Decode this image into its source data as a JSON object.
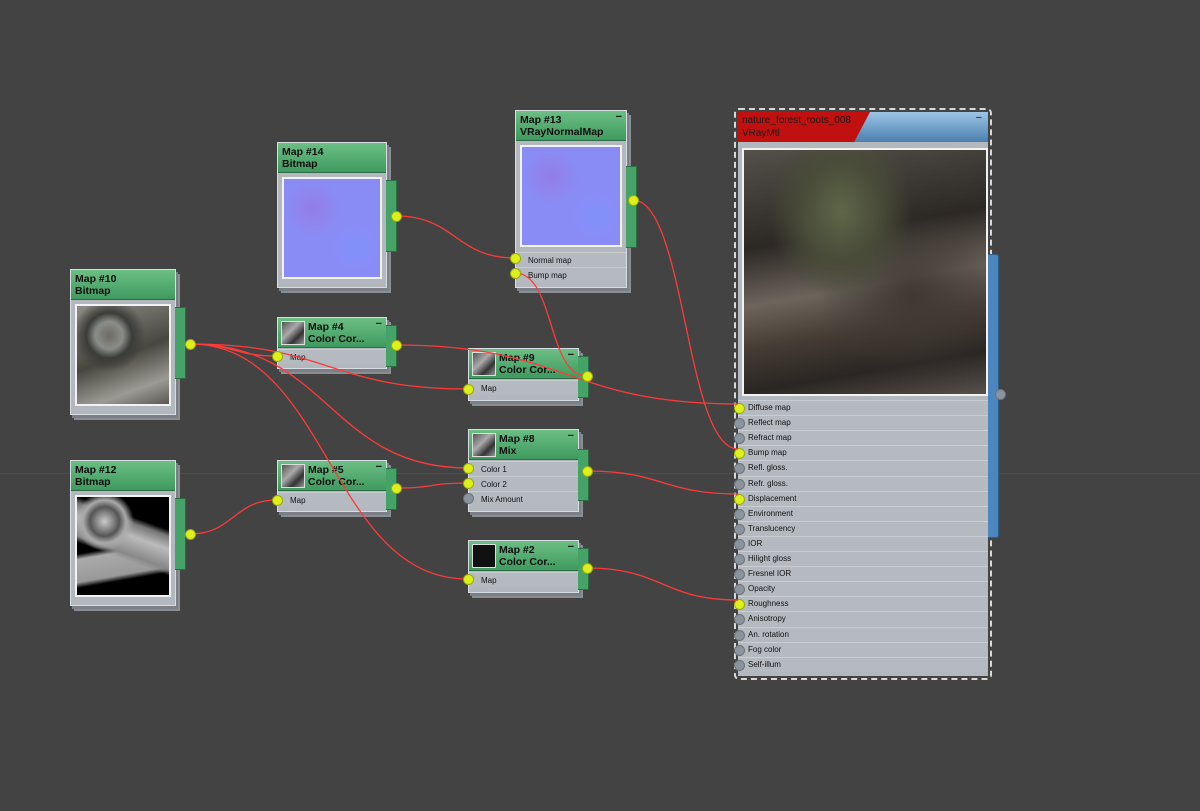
{
  "nodes": {
    "map10": {
      "title": "Map #10",
      "type": "Bitmap"
    },
    "map12": {
      "title": "Map #12",
      "type": "Bitmap"
    },
    "map14": {
      "title": "Map #14",
      "type": "Bitmap"
    },
    "map13": {
      "title": "Map #13",
      "type": "VRayNormalMap",
      "slots": [
        "Normal map",
        "Bump map"
      ]
    },
    "map4": {
      "title": "Map #4",
      "type": "Color Cor...",
      "slots": [
        "Map"
      ]
    },
    "map5": {
      "title": "Map #5",
      "type": "Color Cor...",
      "slots": [
        "Map"
      ]
    },
    "map9": {
      "title": "Map #9",
      "type": "Color Cor...",
      "slots": [
        "Map"
      ]
    },
    "map8": {
      "title": "Map #8",
      "type": "Mix",
      "slots": [
        "Color 1",
        "Color 2",
        "Mix Amount"
      ]
    },
    "map2": {
      "title": "Map #2",
      "type": "Color Cor...",
      "slots": [
        "Map"
      ]
    }
  },
  "material": {
    "name": "nature_forest_roots_008",
    "type": "VRayMtl",
    "slots": [
      "Diffuse map",
      "Reflect map",
      "Refract map",
      "Bump map",
      "Refl. gloss.",
      "Refr. gloss.",
      "Displacement",
      "Environment",
      "Translucency",
      "IOR",
      "Hilight gloss",
      "Fresnel IOR",
      "Opacity",
      "Roughness",
      "Anisotropy",
      "An. rotation",
      "Fog color",
      "Self-illum"
    ],
    "connected_slots": [
      "Diffuse map",
      "Bump map",
      "Displacement",
      "Roughness"
    ]
  },
  "ui": {
    "minimize_glyph": "−"
  },
  "colors": {
    "node_header": "#4fae6f",
    "material_header": "#6d9cc8",
    "material_selected": "#c01010",
    "wire": "#ff3a3a",
    "socket_active": "#ddf01a",
    "background": "#434343"
  }
}
